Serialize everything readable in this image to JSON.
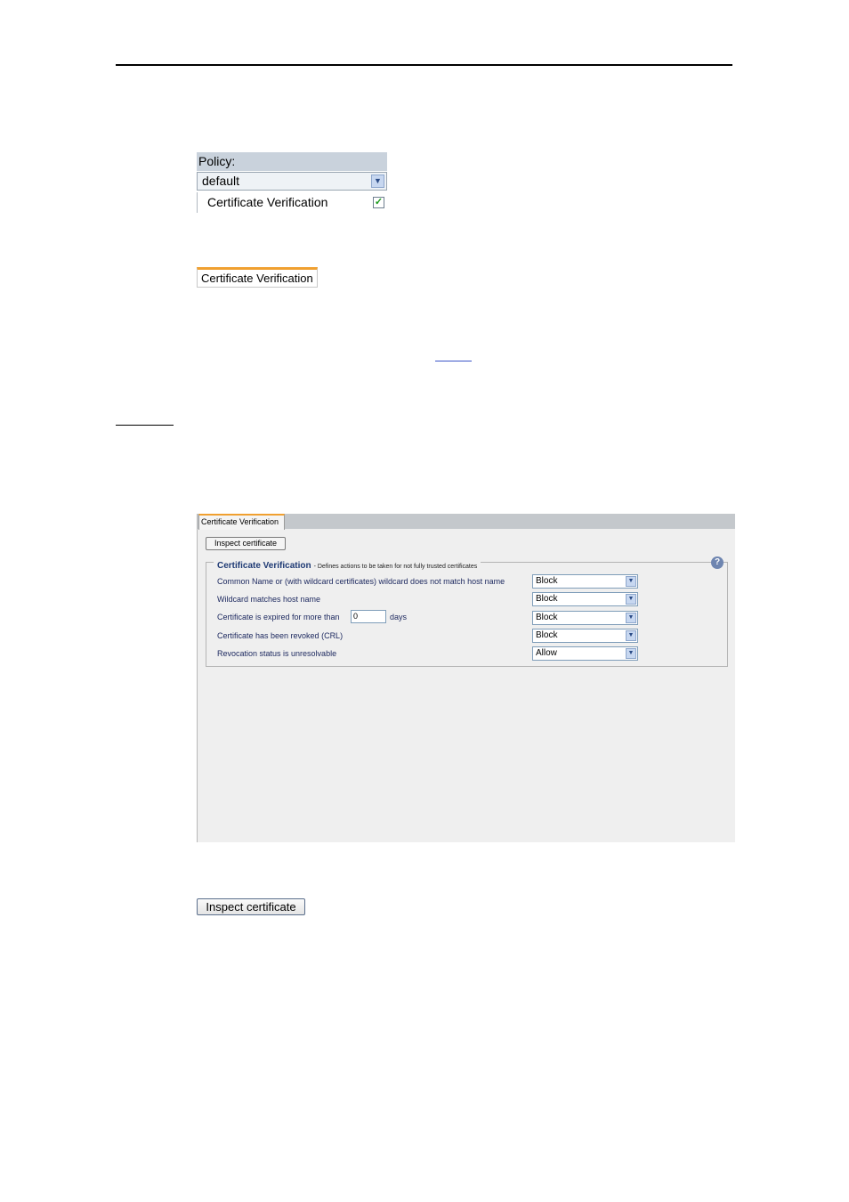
{
  "policy_widget": {
    "header": "Policy:",
    "selected": "default",
    "row_label": "Certificate Verification",
    "row_checked": true
  },
  "small_tab": {
    "label": "Certificate Verification"
  },
  "dialog": {
    "tab_label": "Certificate Verification",
    "inspect_button": "Inspect certificate",
    "group_title": "Certificate Verification",
    "group_subtitle": "- Defines actions to be taken for not fully trusted certificates",
    "help": "?",
    "rows": [
      {
        "label": "Common Name or (with wildcard certificates) wildcard does not match host name",
        "value": "Block"
      },
      {
        "label": "Wildcard matches host name",
        "value": "Block"
      },
      {
        "label": "Certificate is expired for more than",
        "value": "Block",
        "days_value": "0",
        "days_label": "days"
      },
      {
        "label": "Certificate has been revoked (CRL)",
        "value": "Block"
      },
      {
        "label": "Revocation status is unresolvable",
        "value": "Allow"
      }
    ]
  },
  "inspect_button_large": {
    "label": "Inspect certificate"
  },
  "icons": {
    "dropdown": "chevron-down-icon",
    "check": "checkmark-icon",
    "help": "help-icon"
  },
  "colors": {
    "tab_accent": "#f0a030",
    "label_text": "#1e2a60",
    "help_bg": "#6e85b0"
  }
}
